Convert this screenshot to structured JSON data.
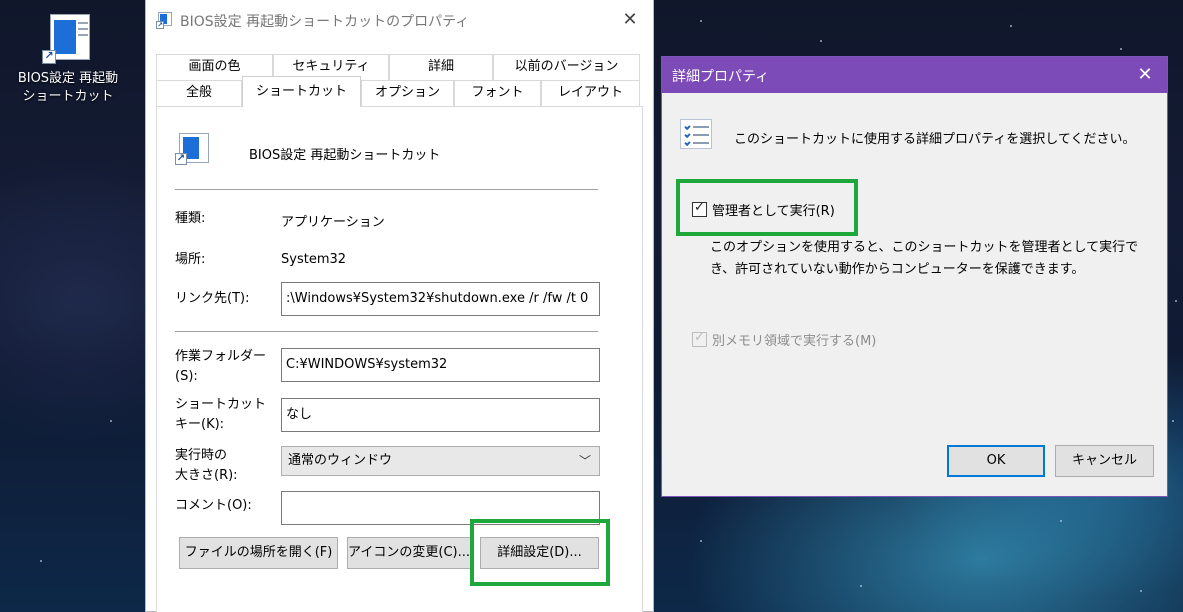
{
  "desktop": {
    "icon_label_line1": "BIOS設定 再起動",
    "icon_label_line2": "ショートカット"
  },
  "props_dialog": {
    "title": "BIOS設定 再起動ショートカットのプロパティ",
    "tabs_row1": [
      "画面の色",
      "セキュリティ",
      "詳細",
      "以前のバージョン"
    ],
    "tabs_row2": [
      "全般",
      "ショートカット",
      "オプション",
      "フォント",
      "レイアウト"
    ],
    "active_tab": "ショートカット",
    "shortcut_name": "BIOS設定 再起動ショートカット",
    "type_label": "種類:",
    "type_value": "アプリケーション",
    "location_label": "場所:",
    "location_value": "System32",
    "target_label": "リンク先(T):",
    "target_value": ":\\Windows¥System32¥shutdown.exe /r /fw /t 0",
    "workdir_label_line1": "作業フォルダー",
    "workdir_label_line2": "(S):",
    "workdir_value": "C:¥WINDOWS¥system32",
    "hotkey_label_line1": "ショートカット",
    "hotkey_label_line2": "キー(K):",
    "hotkey_value": "なし",
    "runsize_label_line1": "実行時の",
    "runsize_label_line2": "大きさ(R):",
    "runsize_value": "通常のウィンドウ",
    "comment_label": "コメント(O):",
    "comment_value": "",
    "buttons": {
      "open_location": "ファイルの場所を開く(F)",
      "change_icon": "アイコンの変更(C)...",
      "advanced": "詳細設定(D)..."
    }
  },
  "adv_dialog": {
    "title": "詳細プロパティ",
    "prompt": "このショートカットに使用する詳細プロパティを選択してください。",
    "run_as_admin_label": "管理者として実行(R)",
    "run_as_admin_checked": true,
    "desc_line1": "このオプションを使用すると、このショートカットを管理者として実行で",
    "desc_line2": "き、許可されていない動作からコンピューターを保護できます。",
    "separate_memory_label": "別メモリ領域で実行する(M)",
    "separate_memory_checked": true,
    "separate_memory_enabled": false,
    "ok_label": "OK",
    "cancel_label": "キャンセル"
  },
  "colors": {
    "highlight_green": "#1ea83c",
    "adv_titlebar": "#7d4bb8"
  }
}
